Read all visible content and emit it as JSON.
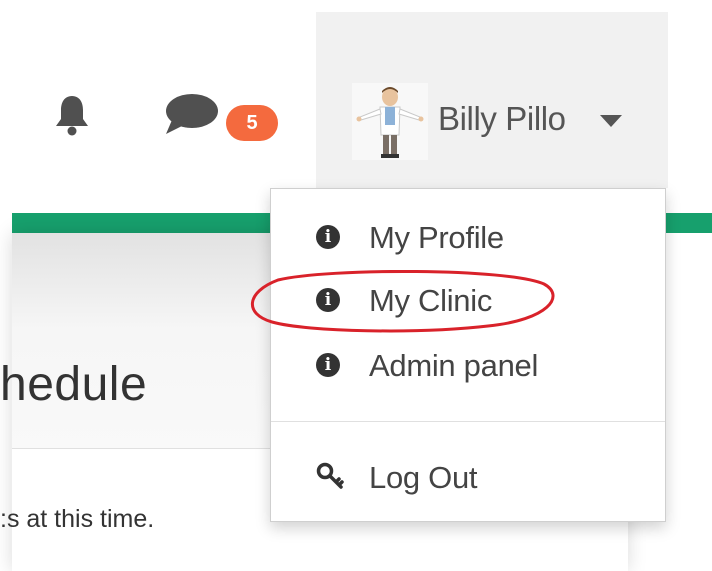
{
  "header": {
    "notifications_icon": "bell-icon",
    "messages_icon": "chat-icon",
    "message_count": "5",
    "user": {
      "name": "Billy Pillo",
      "avatar": "doctor-avatar",
      "caret_icon": "caret-down-icon"
    }
  },
  "page": {
    "heading_fragment": "hedule",
    "body_fragment": ":s at this time."
  },
  "dropdown": {
    "items": [
      {
        "label": "My Profile",
        "icon": "info-icon"
      },
      {
        "label": "My Clinic",
        "icon": "info-icon"
      },
      {
        "label": "Admin panel",
        "icon": "info-icon"
      }
    ],
    "logout": {
      "label": "Log Out",
      "icon": "key-icon"
    }
  },
  "colors": {
    "accent_green": "#17a06d",
    "badge_orange": "#f46a3e",
    "annotation_red": "#d9222a"
  }
}
